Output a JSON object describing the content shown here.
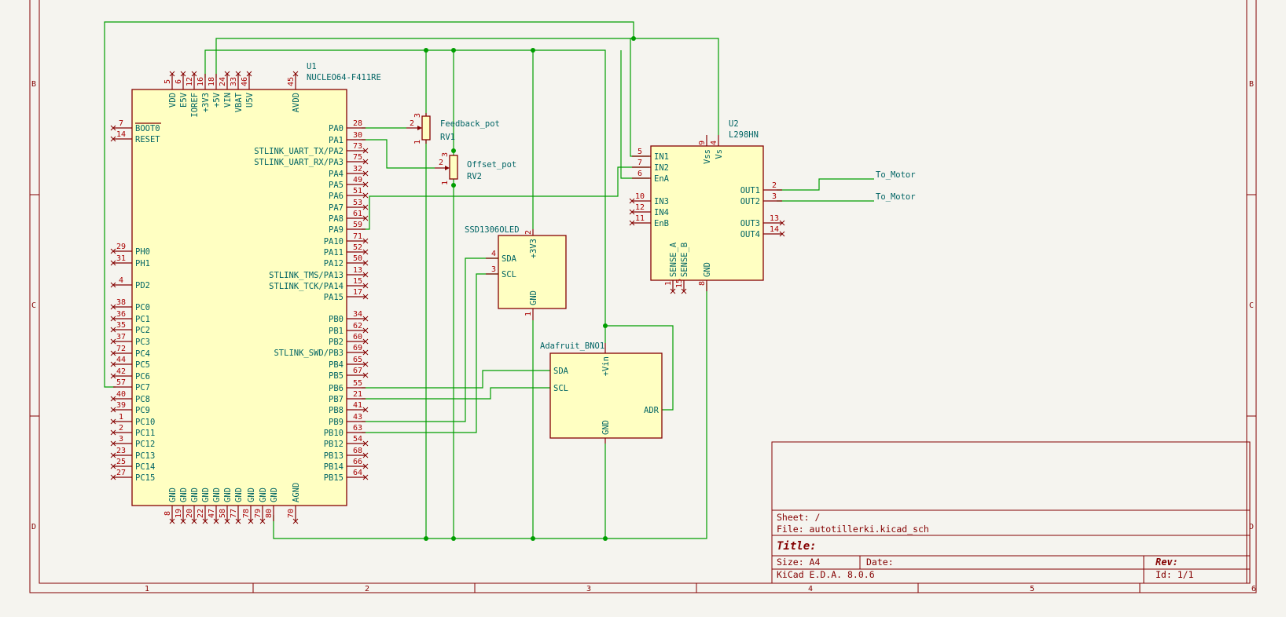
{
  "title_block": {
    "sheet": "Sheet: /",
    "file": "File: autotillerki.kicad_sch",
    "title": "Title:",
    "size": "Size: A4",
    "date": "Date:",
    "rev": "Rev:",
    "tool": "KiCad E.D.A. 8.0.6",
    "id": "Id: 1/1"
  },
  "zones": {
    "columns": [
      "1",
      "2",
      "3",
      "4",
      "5",
      "6"
    ],
    "rows": [
      "B",
      "C",
      "D"
    ]
  },
  "colors": {
    "wire": "#009e00",
    "symbol_outline": "#840000",
    "symbol_fill": "#ffffc2",
    "text": "#006464",
    "background": "#f5f4ef"
  },
  "components": {
    "u1": {
      "ref": "U1",
      "value": "NUCLEO64-F411RE",
      "top_pins": [
        {
          "num": "5",
          "name": "VDD"
        },
        {
          "num": "6",
          "name": "E5V"
        },
        {
          "num": "12",
          "name": "IOREF"
        },
        {
          "num": "16",
          "name": "+3V3"
        },
        {
          "num": "18",
          "name": "+5V"
        },
        {
          "num": "24",
          "name": "VIN"
        },
        {
          "num": "33",
          "name": "VBAT"
        },
        {
          "num": "46",
          "name": "U5V"
        },
        {
          "num": "45",
          "name": "AVDD"
        }
      ],
      "left_pins": [
        {
          "num": "7",
          "name": "BOOT0"
        },
        {
          "num": "14",
          "name": "RESET"
        },
        {
          "num": "29",
          "name": "PH0"
        },
        {
          "num": "31",
          "name": "PH1"
        },
        {
          "num": "4",
          "name": "PD2"
        },
        {
          "num": "38",
          "name": "PC0"
        },
        {
          "num": "36",
          "name": "PC1"
        },
        {
          "num": "35",
          "name": "PC2"
        },
        {
          "num": "37",
          "name": "PC3"
        },
        {
          "num": "72",
          "name": "PC4"
        },
        {
          "num": "44",
          "name": "PC5"
        },
        {
          "num": "42",
          "name": "PC6"
        },
        {
          "num": "57",
          "name": "PC7"
        },
        {
          "num": "40",
          "name": "PC8"
        },
        {
          "num": "39",
          "name": "PC9"
        },
        {
          "num": "1",
          "name": "PC10"
        },
        {
          "num": "2",
          "name": "PC11"
        },
        {
          "num": "3",
          "name": "PC12"
        },
        {
          "num": "23",
          "name": "PC13"
        },
        {
          "num": "25",
          "name": "PC14"
        },
        {
          "num": "27",
          "name": "PC15"
        }
      ],
      "right_pins": [
        {
          "num": "28",
          "name": "PA0"
        },
        {
          "num": "30",
          "name": "PA1"
        },
        {
          "num": "73",
          "name": "STLINK_UART_TX/PA2"
        },
        {
          "num": "75",
          "name": "STLINK_UART_RX/PA3"
        },
        {
          "num": "32",
          "name": "PA4"
        },
        {
          "num": "49",
          "name": "PA5"
        },
        {
          "num": "51",
          "name": "PA6"
        },
        {
          "num": "53",
          "name": "PA7"
        },
        {
          "num": "61",
          "name": "PA8"
        },
        {
          "num": "59",
          "name": "PA9"
        },
        {
          "num": "71",
          "name": "PA10"
        },
        {
          "num": "52",
          "name": "PA11"
        },
        {
          "num": "50",
          "name": "PA12"
        },
        {
          "num": "13",
          "name": "STLINK_TMS/PA13"
        },
        {
          "num": "15",
          "name": "STLINK_TCK/PA14"
        },
        {
          "num": "17",
          "name": "PA15"
        },
        {
          "num": "34",
          "name": "PB0"
        },
        {
          "num": "62",
          "name": "PB1"
        },
        {
          "num": "60",
          "name": "PB2"
        },
        {
          "num": "69",
          "name": "STLINK_SWD/PB3"
        },
        {
          "num": "65",
          "name": "PB4"
        },
        {
          "num": "67",
          "name": "PB5"
        },
        {
          "num": "55",
          "name": "PB6"
        },
        {
          "num": "21",
          "name": "PB7"
        },
        {
          "num": "41",
          "name": "PB8"
        },
        {
          "num": "43",
          "name": "PB9"
        },
        {
          "num": "63",
          "name": "PB10"
        },
        {
          "num": "54",
          "name": "PB12"
        },
        {
          "num": "68",
          "name": "PB13"
        },
        {
          "num": "66",
          "name": "PB14"
        },
        {
          "num": "64",
          "name": "PB15"
        }
      ],
      "bottom_pins": [
        {
          "num": "8",
          "name": "GND"
        },
        {
          "num": "19",
          "name": "GND"
        },
        {
          "num": "20",
          "name": "GND"
        },
        {
          "num": "22",
          "name": "GND"
        },
        {
          "num": "47",
          "name": "GND"
        },
        {
          "num": "58",
          "name": "GND"
        },
        {
          "num": "77",
          "name": "GND"
        },
        {
          "num": "78",
          "name": "GND"
        },
        {
          "num": "79",
          "name": "GND"
        },
        {
          "num": "80",
          "name": "GND"
        },
        {
          "num": "70",
          "name": "AGND"
        }
      ]
    },
    "u2": {
      "ref": "U2",
      "value": "L298HN",
      "top_pins": [
        {
          "num": "9",
          "name": "Vss"
        },
        {
          "num": "4",
          "name": "Vs"
        }
      ],
      "left_pins": [
        {
          "num": "5",
          "name": "IN1"
        },
        {
          "num": "7",
          "name": "IN2"
        },
        {
          "num": "6",
          "name": "EnA"
        },
        {
          "num": "10",
          "name": "IN3"
        },
        {
          "num": "12",
          "name": "IN4"
        },
        {
          "num": "11",
          "name": "EnB"
        }
      ],
      "right_pins": [
        {
          "num": "2",
          "name": "OUT1"
        },
        {
          "num": "3",
          "name": "OUT2"
        },
        {
          "num": "13",
          "name": "OUT3"
        },
        {
          "num": "14",
          "name": "OUT4"
        }
      ],
      "bottom_pins": [
        {
          "num": "1",
          "name": "SENSE_A"
        },
        {
          "num": "15",
          "name": "SENSE_B"
        },
        {
          "num": "8",
          "name": "GND"
        }
      ]
    },
    "oled": {
      "value": "SSD1306OLED",
      "left_pins": [
        {
          "num": "4",
          "name": "SDA"
        },
        {
          "num": "3",
          "name": "SCL"
        }
      ],
      "top_pin": {
        "num": "2",
        "name": "+3V3"
      },
      "bottom_pin": {
        "num": "1",
        "name": "GND"
      }
    },
    "bno": {
      "value": "Adafruit_BNO1",
      "left_pins": [
        {
          "num": "",
          "name": "SDA"
        },
        {
          "num": "",
          "name": "SCL"
        }
      ],
      "top_pin": {
        "num": "",
        "name": "+Vin"
      },
      "bottom_pin": {
        "num": "",
        "name": "GND"
      },
      "right_pin": {
        "num": "",
        "name": "ADR"
      }
    },
    "rv1": {
      "ref": "RV1",
      "value": "Feedback_pot",
      "pins": {
        "wiper": "2",
        "top": "3",
        "bottom": "1"
      }
    },
    "rv2": {
      "ref": "RV2",
      "value": "Offset_pot",
      "pins": {
        "wiper": "2",
        "top": "3",
        "bottom": "1"
      }
    }
  },
  "net_labels": [
    "To_Motor",
    "To_Motor"
  ]
}
